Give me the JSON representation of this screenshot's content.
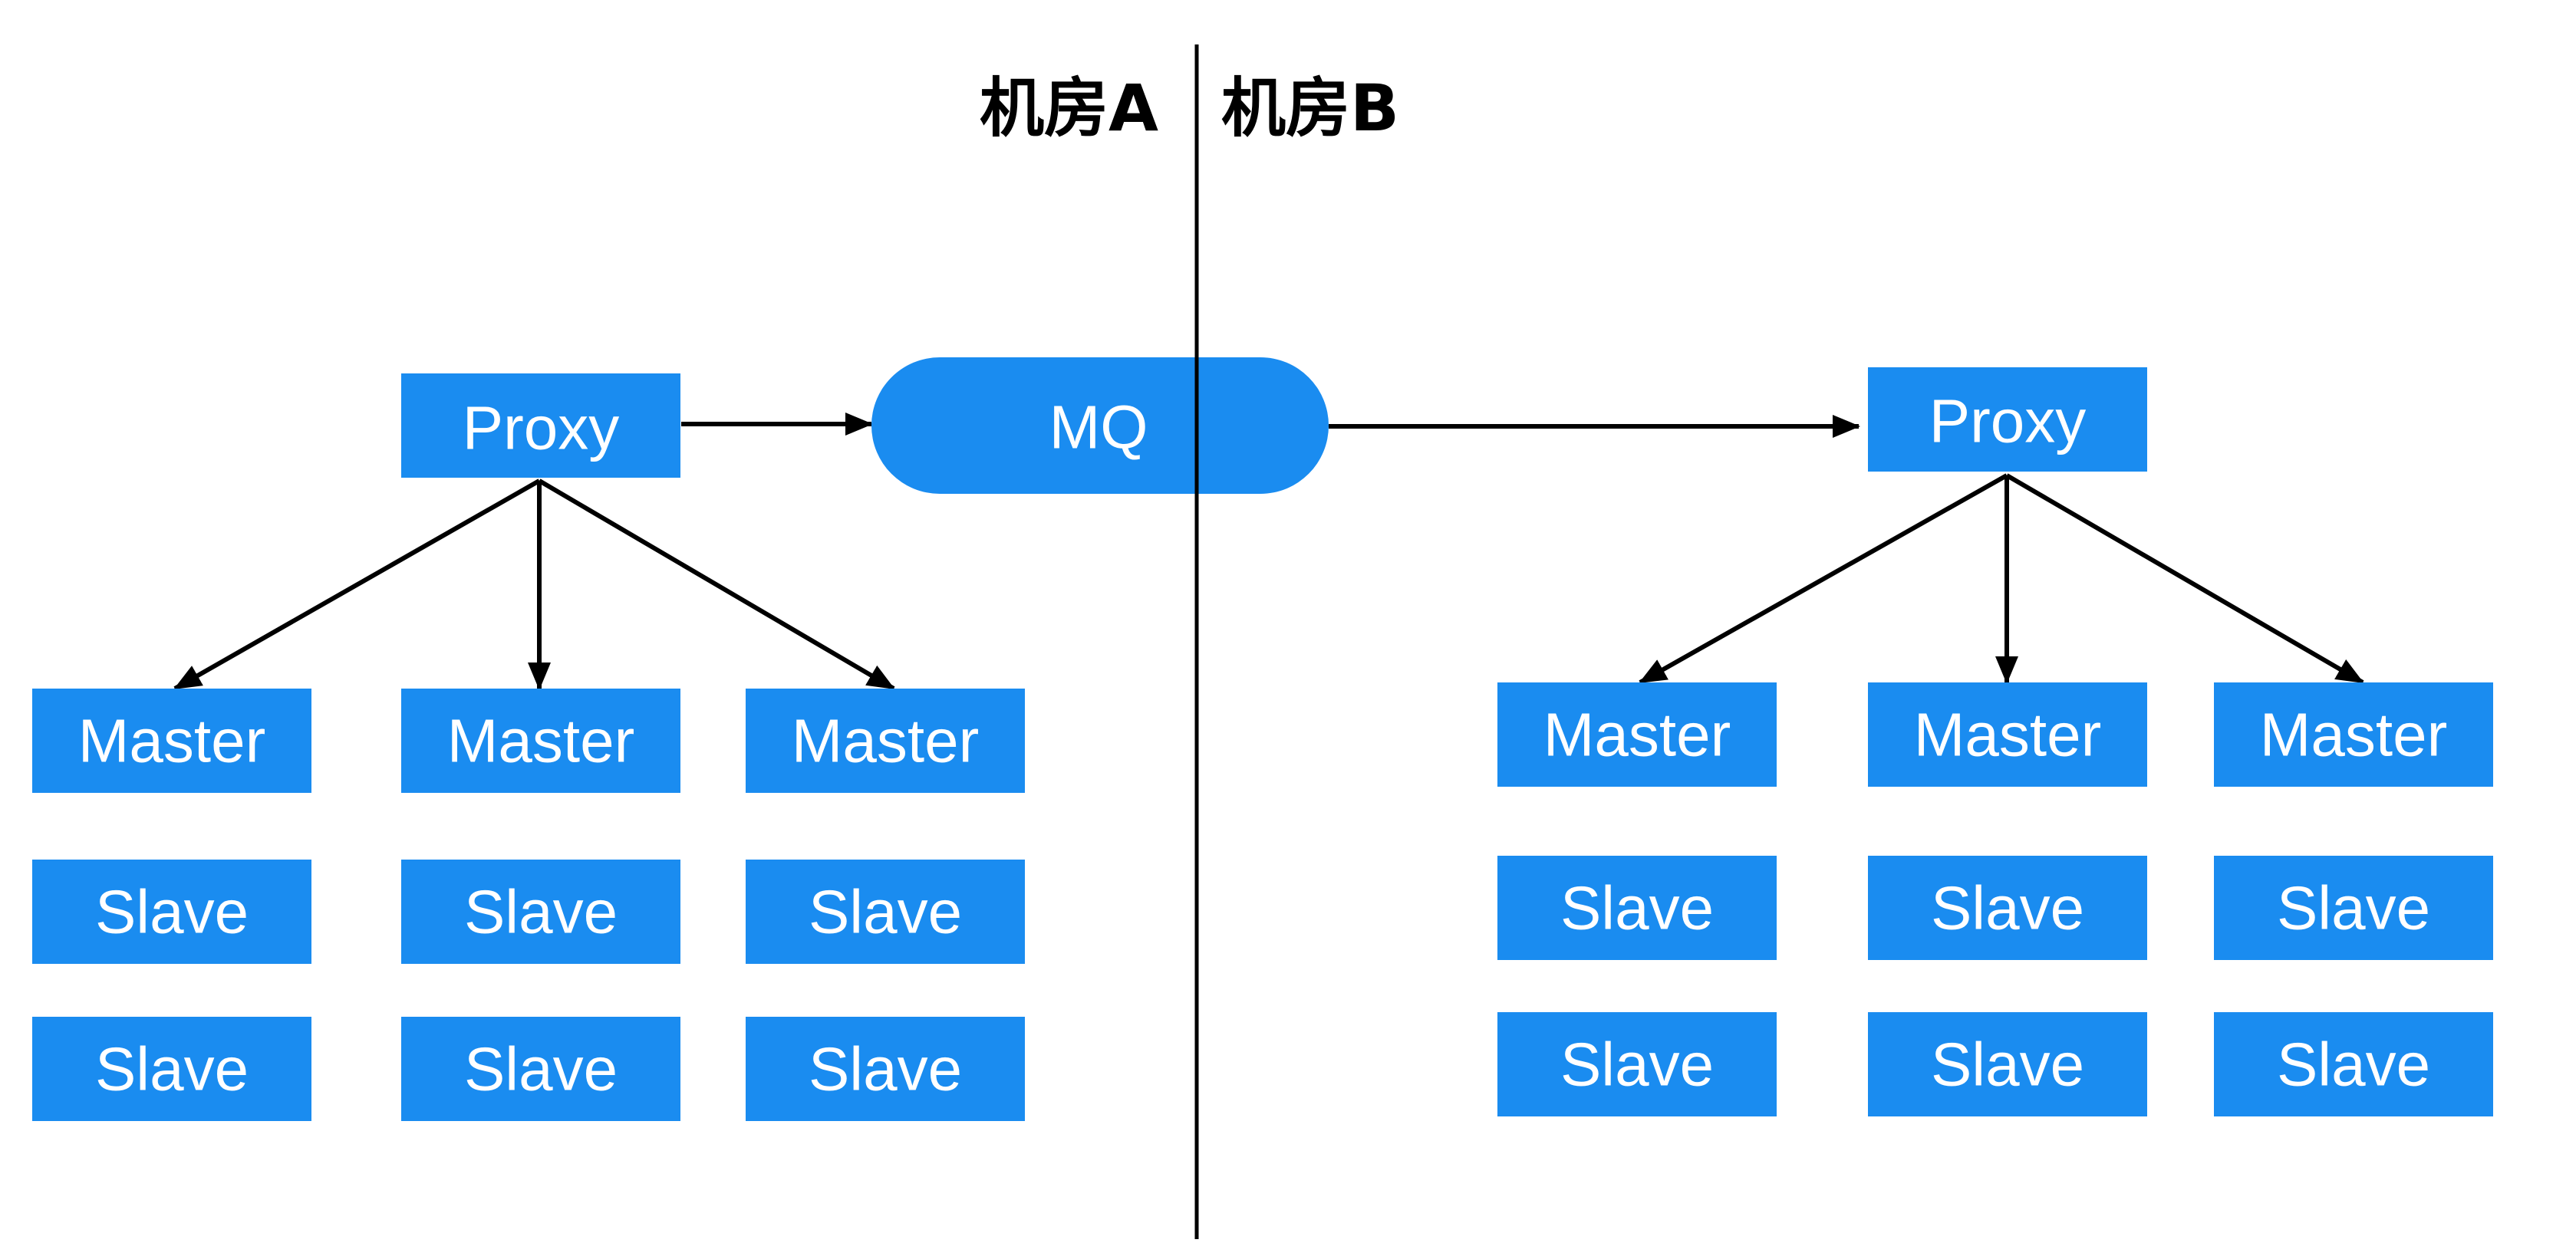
{
  "colors": {
    "node": "#1a8cf0",
    "edge": "#000000",
    "label_text": "#ffffff"
  },
  "datacenters": {
    "a": {
      "label": "机房A"
    },
    "b": {
      "label": "机房B"
    }
  },
  "mq": {
    "label": "MQ"
  },
  "site_a": {
    "proxy": "Proxy",
    "columns": [
      {
        "master": "Master",
        "slaves": [
          "Slave",
          "Slave"
        ]
      },
      {
        "master": "Master",
        "slaves": [
          "Slave",
          "Slave"
        ]
      },
      {
        "master": "Master",
        "slaves": [
          "Slave",
          "Slave"
        ]
      }
    ]
  },
  "site_b": {
    "proxy": "Proxy",
    "columns": [
      {
        "master": "Master",
        "slaves": [
          "Slave",
          "Slave"
        ]
      },
      {
        "master": "Master",
        "slaves": [
          "Slave",
          "Slave"
        ]
      },
      {
        "master": "Master",
        "slaves": [
          "Slave",
          "Slave"
        ]
      }
    ]
  }
}
